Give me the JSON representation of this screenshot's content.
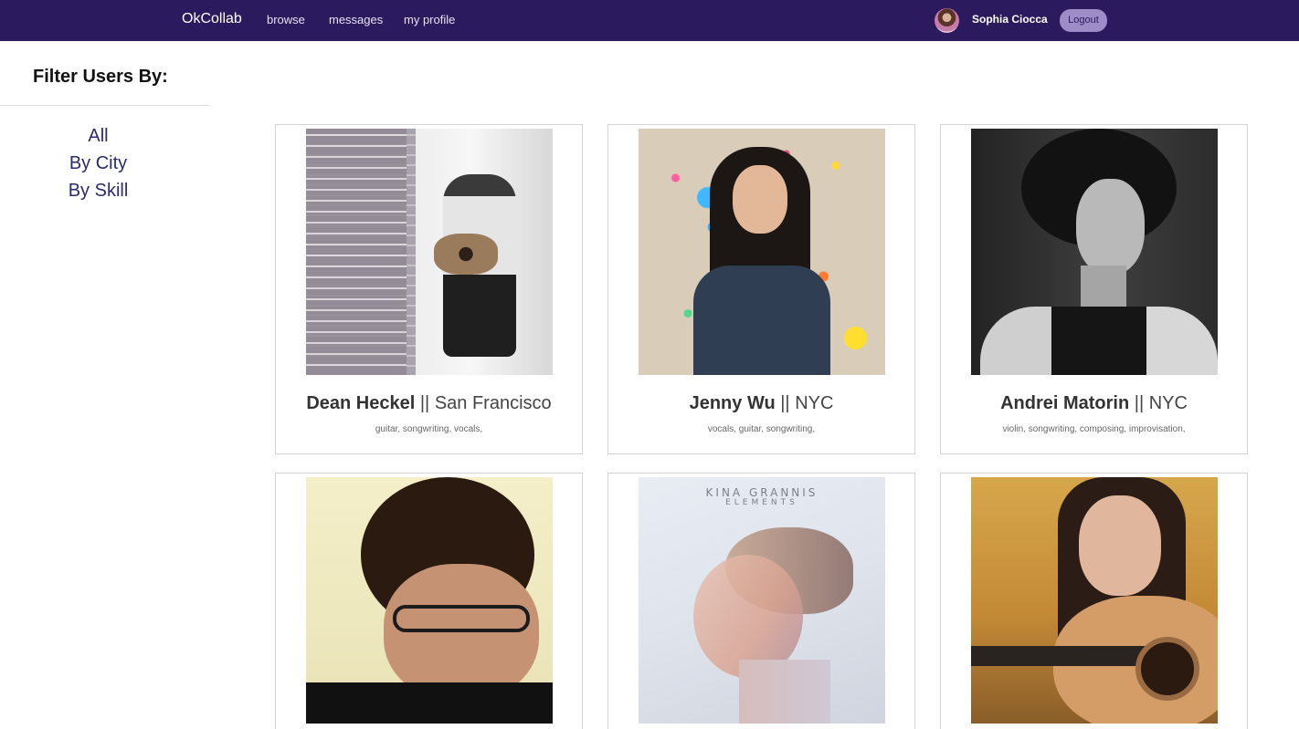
{
  "navbar": {
    "brand": "OkCollab",
    "links": [
      "browse",
      "messages",
      "my profile"
    ],
    "user_name": "Sophia Ciocca",
    "logout_label": "Logout"
  },
  "sidebar": {
    "title": "Filter Users By:",
    "filters": [
      "All",
      "By City",
      "By Skill"
    ]
  },
  "users": [
    {
      "name": "Dean Heckel",
      "separator": "||",
      "city": "San Francisco",
      "skills": "guitar, songwriting, vocals,"
    },
    {
      "name": "Jenny Wu",
      "separator": "||",
      "city": "NYC",
      "skills": "vocals, guitar, songwriting,"
    },
    {
      "name": "Andrei Matorin",
      "separator": "||",
      "city": "NYC",
      "skills": "violin, songwriting, composing, improvisation,"
    },
    {
      "name": "",
      "city": "",
      "skills": ""
    },
    {
      "name": "",
      "city": "",
      "skills": "",
      "photo_text": [
        "KINA GRANNIS",
        "ELEMENTS"
      ]
    },
    {
      "name": "",
      "city": "",
      "skills": ""
    }
  ],
  "colors": {
    "navbar_bg": "#2b1a5e",
    "logout_bg": "#9d8cc7",
    "filter_link": "#2b2a6e"
  },
  "icons": [
    "user-avatar"
  ]
}
